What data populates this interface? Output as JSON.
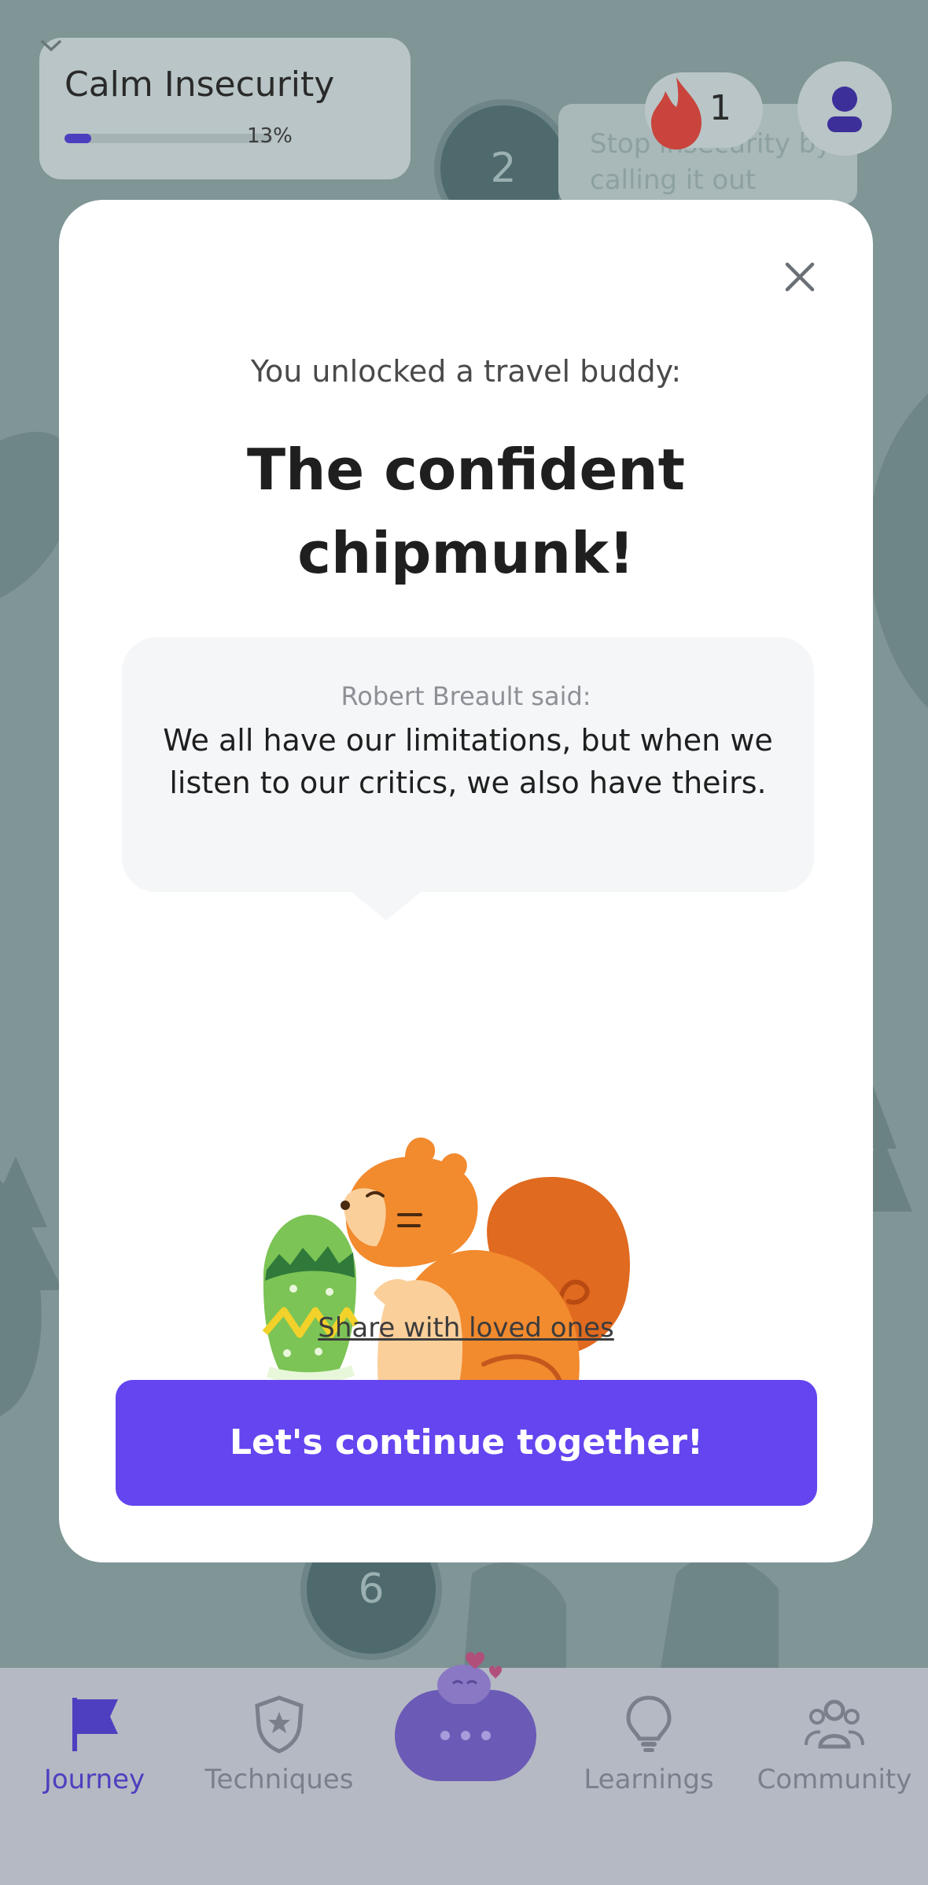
{
  "course": {
    "title": "Calm Insecurity",
    "progress_percent": 13,
    "progress_label": "13%"
  },
  "streak": {
    "count": "1"
  },
  "map": {
    "node_2": "2",
    "node_6": "6",
    "step_hint": "Stop insecurity by calling it out"
  },
  "modal": {
    "subtitle": "You unlocked a travel buddy:",
    "title_line1": "The confident",
    "title_line2": "chipmunk!",
    "quote_author": "Robert Breault said:",
    "quote_text": "We all have our limitations, but when we listen to our critics, we also have theirs.",
    "share_label": "Share with loved ones",
    "continue_label": "Let's continue together!"
  },
  "nav": {
    "items": [
      {
        "label": "Journey",
        "icon": "flag-icon",
        "active": true
      },
      {
        "label": "Techniques",
        "icon": "shield-star-icon",
        "active": false
      },
      {
        "label": "Learnings",
        "icon": "lightbulb-icon",
        "active": false
      },
      {
        "label": "Community",
        "icon": "people-icon",
        "active": false
      }
    ],
    "chat_icon": "chat-bubble-icon"
  },
  "colors": {
    "accent": "#6445ef",
    "nav_active": "#4d3fbf",
    "overlay_bg": "#7f9596",
    "chipmunk": "#f28a2e"
  }
}
